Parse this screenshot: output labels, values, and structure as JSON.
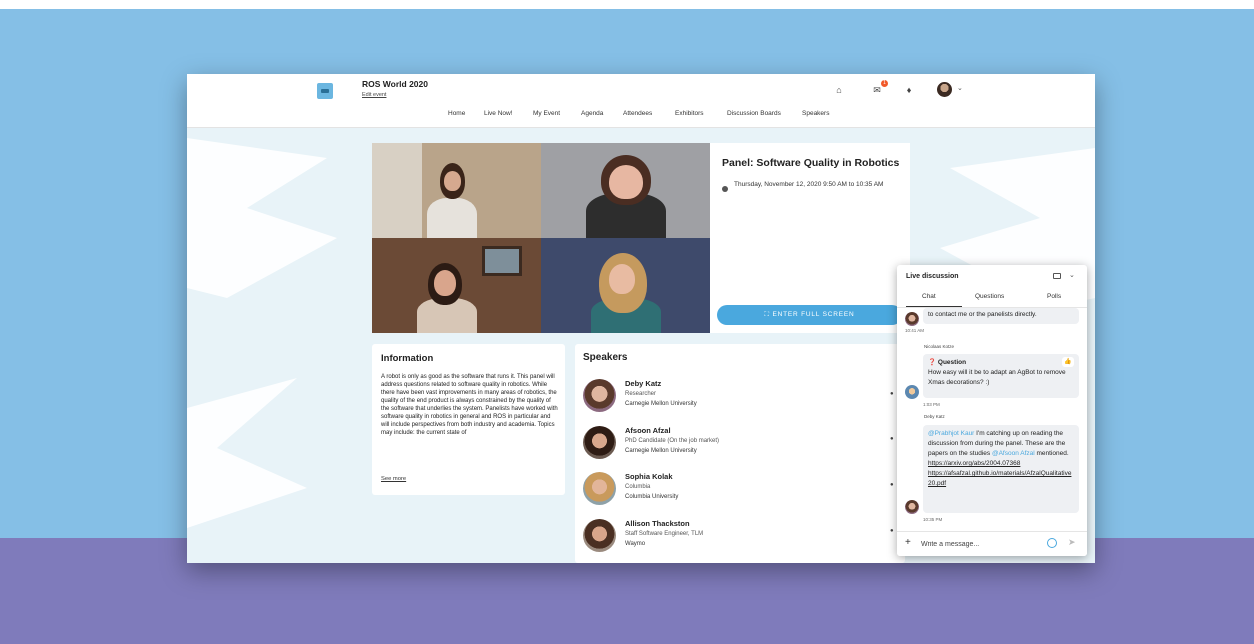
{
  "header": {
    "event_title": "ROS World 2020",
    "edit_event": "Edit event",
    "notification_count": "1",
    "nav": [
      "Home",
      "Live Now!",
      "My Event",
      "Agenda",
      "Attendees",
      "Exhibitors",
      "Discussion Boards",
      "Speakers"
    ]
  },
  "session": {
    "title": "Panel: Software Quality in Robotics",
    "time": "Thursday, November 12, 2020 9:50 AM to 10:35 AM",
    "fullscreen_label": "ENTER FULL SCREEN"
  },
  "information": {
    "title": "Information",
    "text": "A robot is only as good as the software that runs it. This panel will address questions related to software quality in robotics. While there have been vast improvements in many areas of robotics, the quality of the end product is always constrained by the quality of the software that underlies the system. Panelists have worked with software quality in robotics in general and ROS in particular and will include perspectives from both industry and academia. Topics may include: the current state of",
    "see_more": "See more"
  },
  "speakers": {
    "title": "Speakers",
    "items": [
      {
        "name": "Deby Katz",
        "role": "Researcher",
        "org": "Carnegie Mellon University"
      },
      {
        "name": "Afsoon Afzal",
        "role": "PhD Candidate (On the job market)",
        "org": "Carnegie Mellon University"
      },
      {
        "name": "Sophia Kolak",
        "role": "Columbia",
        "org": "Columbia University"
      },
      {
        "name": "Allison Thackston",
        "role": "Staff Software Engineer, TLM",
        "org": "Waymo"
      }
    ]
  },
  "chat": {
    "title": "Live discussion",
    "tabs": [
      "Chat",
      "Questions",
      "Polls"
    ],
    "msg1_text": "to contact me or the panelists directly.",
    "msg1_time": "10:41 AM",
    "msg2_author": "Nicolaas Kotze",
    "msg2_label": "Question",
    "msg2_text": "How easy will it be to adapt an AgBot to remove Xmas decorations? :)",
    "msg2_time": "1:03 PM",
    "msg3_author": "Deby Katz",
    "msg3_mention1": "@Prabhjot Kaur",
    "msg3_text1": " I'm catching up on reading the discussion from during the panel. These are the papers on the studies ",
    "msg3_mention2": "@Afsoon Afzal",
    "msg3_text2": " mentioned.",
    "msg3_link1": "https://arxiv.org/abs/2004.07368",
    "msg3_link2": "https://afsafzal.github.io/materials/AfzalQualitative20.pdf",
    "msg3_time": "10:35 PM",
    "input_placeholder": "Write a message..."
  }
}
